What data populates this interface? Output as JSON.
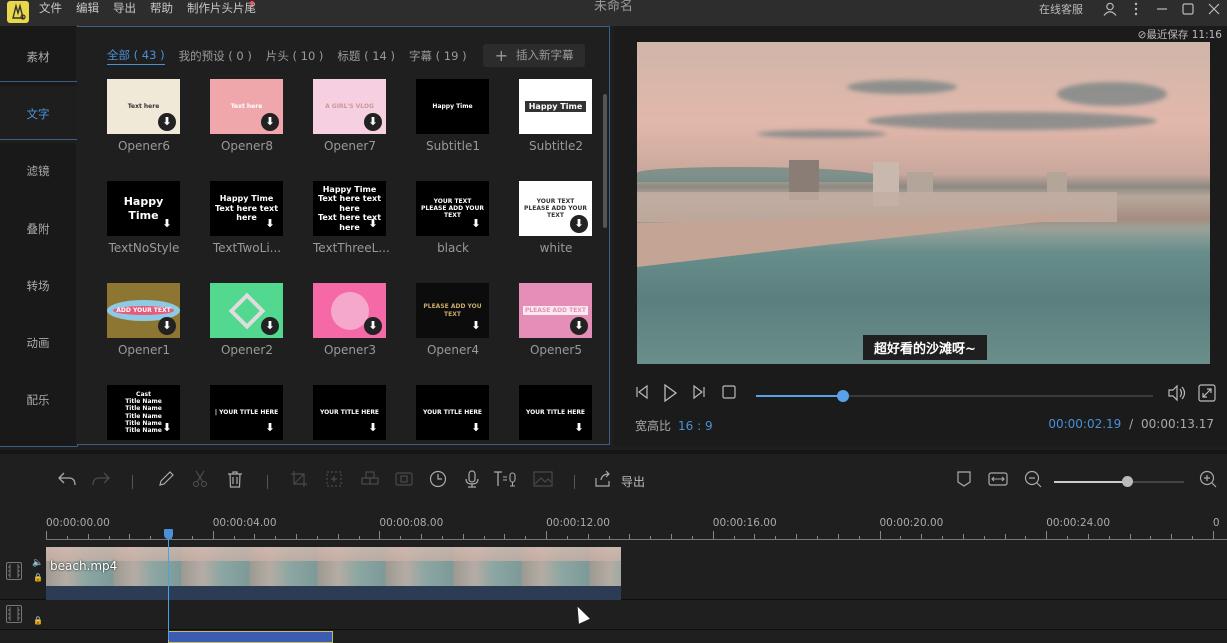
{
  "app": {
    "logo_glyph": "🐰",
    "title": "未命名",
    "menu": [
      "文件",
      "编辑",
      "导出",
      "帮助",
      "制作片头片尾"
    ],
    "online_service": "在线客服",
    "icons": {
      "user": "user-icon",
      "more": "more-icon",
      "minimize": "minimize-icon",
      "maximize": "maximize-icon",
      "close": "close-icon"
    }
  },
  "sidebar": {
    "items": [
      {
        "label": "素材",
        "active": false
      },
      {
        "label": "文字",
        "active": true
      },
      {
        "label": "滤镜",
        "active": false
      },
      {
        "label": "叠附",
        "active": false
      },
      {
        "label": "转场",
        "active": false
      },
      {
        "label": "动画",
        "active": false
      },
      {
        "label": "配乐",
        "active": false
      }
    ]
  },
  "library": {
    "tabs": [
      {
        "label": "全部 ( 43 )",
        "active": true
      },
      {
        "label": "我的预设 ( 0 )",
        "active": false
      },
      {
        "label": "片头 ( 10 )",
        "active": false
      },
      {
        "label": "标题 ( 14 )",
        "active": false
      },
      {
        "label": "字幕 ( 19 )",
        "active": false
      }
    ],
    "add_subtitle_label": "插入新字幕",
    "items": [
      {
        "name": "Opener6",
        "bg": "#f1e9d8",
        "fg": "#333",
        "text": "Text here"
      },
      {
        "name": "Opener8",
        "bg": "#f0a7ac",
        "fg": "#fff",
        "text": "Text here"
      },
      {
        "name": "Opener7",
        "bg": "#f6cfe0",
        "fg": "#c99",
        "text": "A GIRL'S VLOG"
      },
      {
        "name": "Subtitle1",
        "bg": "#000000",
        "fg": "#fff",
        "text": "Happy Time"
      },
      {
        "name": "Subtitle2",
        "bg": "#ffffff",
        "fg": "#fff",
        "text": "Happy Time"
      },
      {
        "name": "TextNoStyle",
        "bg": "#000000",
        "fg": "#fff",
        "text": "Happy Time"
      },
      {
        "name": "TextTwoLi...",
        "bg": "#000000",
        "fg": "#fff",
        "text": "Happy Time\nText here text here"
      },
      {
        "name": "TextThreeL...",
        "bg": "#000000",
        "fg": "#fff",
        "text": "Happy Time\nText here text here\nText here text here"
      },
      {
        "name": "black",
        "bg": "#000000",
        "fg": "#fff",
        "text": "YOUR TEXT\nPLEASE ADD YOUR TEXT"
      },
      {
        "name": "white",
        "bg": "#ffffff",
        "fg": "#333",
        "text": "YOUR TEXT\nPLEASE ADD YOUR TEXT"
      },
      {
        "name": "Opener1",
        "bg": "#8c7632",
        "fg": "#fff",
        "text": "ADD YOUR TEXT"
      },
      {
        "name": "Opener2",
        "bg": "#52d88f",
        "fg": "#ddd",
        "text": ""
      },
      {
        "name": "Opener3",
        "bg": "#f56aa6",
        "fg": "#fff",
        "text": ""
      },
      {
        "name": "Opener4",
        "bg": "#0c0c0c",
        "fg": "#c9a96a",
        "text": "PLEASE ADD YOU TEXT"
      },
      {
        "name": "Opener5",
        "bg": "#e58fb8",
        "fg": "#fff",
        "text": "PLEASE ADD TEXT"
      },
      {
        "name": "",
        "bg": "#000000",
        "fg": "#fff",
        "text": "Cast\nTitle Name\nTitle Name\nTitle Name\nTitle Name\nTitle Name"
      },
      {
        "name": "",
        "bg": "#000000",
        "fg": "#fff",
        "text": "| YOUR TITLE HERE"
      },
      {
        "name": "",
        "bg": "#000000",
        "fg": "#fff",
        "text": "YOUR TITLE HERE"
      },
      {
        "name": "",
        "bg": "#000000",
        "fg": "#fff",
        "text": "YOUR TITLE HERE"
      },
      {
        "name": "",
        "bg": "#000000",
        "fg": "#fff",
        "text": "YOUR TITLE HERE"
      }
    ]
  },
  "preview": {
    "saved_label": "最近保存 11:16",
    "subtitle_text": "超好看的沙滩呀~",
    "progress_fraction": 0.22,
    "aspect_label": "宽高比",
    "aspect_value": "16 : 9",
    "current_time": "00:00:02.19",
    "time_separator": "/",
    "total_time": "00:00:13.17"
  },
  "toolbar": {
    "export_label": "导出",
    "zoom_fraction": 0.56
  },
  "timeline": {
    "ruler_labels": [
      "00:00:00.00",
      "00:00:04.00",
      "00:00:08.00",
      "00:00:12.00",
      "00:00:16.00",
      "00:00:20.00",
      "00:00:24.00",
      "0"
    ],
    "clip_name": "beach.mp4",
    "playhead_time": "00:00:02.19"
  },
  "colors": {
    "accent": "#4a90d9",
    "panel_border": "#3b5f84",
    "clip_bg": "#2c3c55",
    "text_clip": "#3c5bb2"
  }
}
